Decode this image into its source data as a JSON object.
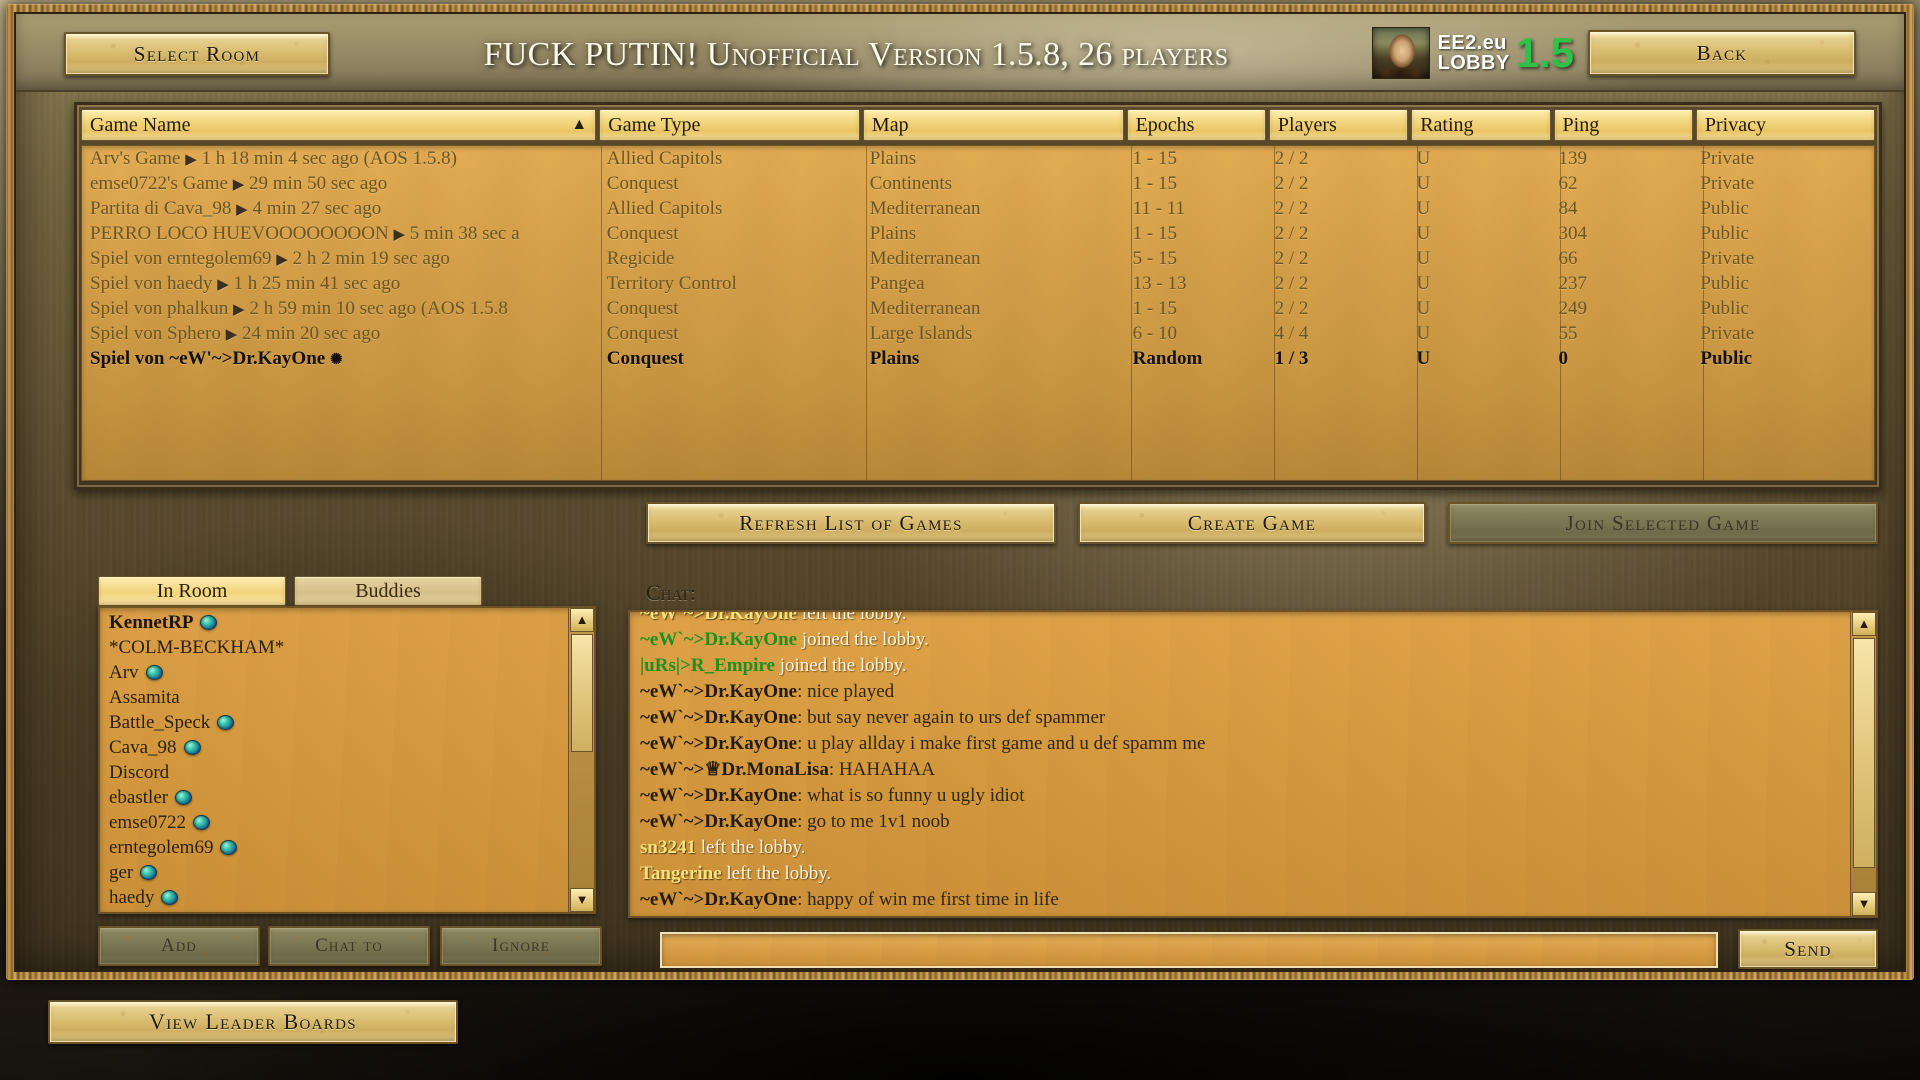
{
  "header": {
    "select_room_label": "Select Room",
    "title": "FUCK PUTIN! Unofficial Version 1.5.8, 26 players",
    "back_label": "Back",
    "logo": {
      "line1": "EE2.eu",
      "line2": "LOBBY",
      "version": "1.5",
      "version_color": "#2fc14a",
      "portrait_icon": "mona-lisa-icon"
    }
  },
  "games_table": {
    "columns": [
      "Game Name",
      "Game Type",
      "Map",
      "Epochs",
      "Players",
      "Rating",
      "Ping",
      "Privacy"
    ],
    "sort_column": "Game Name",
    "sort_indicator": "▲",
    "rows": [
      {
        "name": "Arv's Game",
        "play_icon": "▶",
        "time": "1 h 18 min 4 sec ago (AOS 1.5.8)",
        "type": "Allied Capitols",
        "map": "Plains",
        "epochs": "1 - 15",
        "players": "2 / 2",
        "rating": "U",
        "ping": "139",
        "privacy": "Private",
        "own": false
      },
      {
        "name": "emse0722's Game",
        "play_icon": "▶",
        "time": "29 min 50 sec ago",
        "type": "Conquest",
        "map": "Continents",
        "epochs": "1 - 15",
        "players": "2 / 2",
        "rating": "U",
        "ping": "62",
        "privacy": "Private",
        "own": false
      },
      {
        "name": "Partita di Cava_98",
        "play_icon": "▶",
        "time": "4 min 27 sec ago",
        "type": "Allied Capitols",
        "map": "Mediterranean",
        "epochs": "11 - 11",
        "players": "2 / 2",
        "rating": "U",
        "ping": "84",
        "privacy": "Public",
        "own": false
      },
      {
        "name": "PERRO LOCO HUEVOOOOOOOON",
        "play_icon": "▶",
        "time": "5 min 38 sec a",
        "type": "Conquest",
        "map": "Plains",
        "epochs": "1 - 15",
        "players": "2 / 2",
        "rating": "U",
        "ping": "304",
        "privacy": "Public",
        "own": false
      },
      {
        "name": "Spiel von erntegolem69",
        "play_icon": "▶",
        "time": "2 h 2 min 19 sec ago",
        "type": "Regicide",
        "map": "Mediterranean",
        "epochs": "5 - 15",
        "players": "2 / 2",
        "rating": "U",
        "ping": "66",
        "privacy": "Private",
        "own": false
      },
      {
        "name": "Spiel von haedy",
        "play_icon": "▶",
        "time": "1 h 25 min 41 sec ago",
        "type": "Territory Control",
        "map": "Pangea",
        "epochs": "13 - 13",
        "players": "2 / 2",
        "rating": "U",
        "ping": "237",
        "privacy": "Public",
        "own": false
      },
      {
        "name": "Spiel von phalkun",
        "play_icon": "▶",
        "time": "2 h 59 min 10 sec ago (AOS 1.5.8",
        "type": "Conquest",
        "map": "Mediterranean",
        "epochs": "1 - 15",
        "players": "2 / 2",
        "rating": "U",
        "ping": "249",
        "privacy": "Public",
        "own": false
      },
      {
        "name": "Spiel von Sphero",
        "play_icon": "▶",
        "time": "24 min 20 sec ago",
        "type": "Conquest",
        "map": "Large Islands",
        "epochs": "6 - 10",
        "players": "4 / 4",
        "rating": "U",
        "ping": "55",
        "privacy": "Private",
        "own": false
      },
      {
        "name": "Spiel von ~eW'~>Dr.KayOne",
        "play_icon": "✺",
        "time": "",
        "type": "Conquest",
        "map": "Plains",
        "epochs": "Random",
        "players": "1 / 3",
        "rating": "U",
        "ping": "0",
        "privacy": "Public",
        "own": true
      }
    ]
  },
  "actions": {
    "refresh_label": "Refresh List of Games",
    "create_label": "Create Game",
    "join_label": "Join Selected Game",
    "join_disabled": true
  },
  "tabs": [
    {
      "label": "In Room",
      "active": true
    },
    {
      "label": "Buddies",
      "active": false
    }
  ],
  "player_list": [
    {
      "name": "KennetRP",
      "globe": true,
      "me": true
    },
    {
      "name": "*COLM-BECKHAM*",
      "globe": false,
      "me": false
    },
    {
      "name": "Arv",
      "globe": true,
      "me": false
    },
    {
      "name": "Assamita",
      "globe": false,
      "me": false
    },
    {
      "name": "Battle_Speck",
      "globe": true,
      "me": false
    },
    {
      "name": "Cava_98",
      "globe": true,
      "me": false
    },
    {
      "name": "Discord",
      "globe": false,
      "me": false
    },
    {
      "name": "ebastler",
      "globe": true,
      "me": false
    },
    {
      "name": "emse0722",
      "globe": true,
      "me": false
    },
    {
      "name": "erntegolem69",
      "globe": true,
      "me": false
    },
    {
      "name": "ger",
      "globe": true,
      "me": false
    },
    {
      "name": "haedy",
      "globe": true,
      "me": false
    }
  ],
  "chat": {
    "label": "Chat:",
    "input_value": "",
    "send_label": "Send",
    "lines": [
      {
        "name": "~eW`~>Dr.KayOne",
        "name_style": "gold",
        "msg": " left the lobby.",
        "msg_style": "sys",
        "clipped": true
      },
      {
        "name": "~eW`~>Dr.KayOne",
        "name_style": "green",
        "msg": " joined the lobby.",
        "msg_style": "sys"
      },
      {
        "name": "|uRs|>R_Empire",
        "name_style": "green",
        "msg": " joined the lobby.",
        "msg_style": "sys"
      },
      {
        "name": "~eW`~>Dr.KayOne",
        "name_style": "dark",
        "msg": ": nice played",
        "msg_style": "normal"
      },
      {
        "name": "~eW`~>Dr.KayOne",
        "name_style": "dark",
        "msg": ": but say never again to urs def spammer",
        "msg_style": "normal"
      },
      {
        "name": "~eW`~>Dr.KayOne",
        "name_style": "dark",
        "msg": ": u play allday i make first game and u def spamm me",
        "msg_style": "normal"
      },
      {
        "name": "~eW`~>♕Dr.MonaLisa",
        "name_style": "dark",
        "msg": ": HAHAHAA",
        "msg_style": "normal"
      },
      {
        "name": "~eW`~>Dr.KayOne",
        "name_style": "dark",
        "msg": ": what is so funny u ugly idiot",
        "msg_style": "normal"
      },
      {
        "name": "~eW`~>Dr.KayOne",
        "name_style": "dark",
        "msg": ": go to me 1v1 noob",
        "msg_style": "normal"
      },
      {
        "name": "sn3241",
        "name_style": "gold",
        "msg": " left the lobby.",
        "msg_style": "sys"
      },
      {
        "name": "Tangerine",
        "name_style": "gold",
        "msg": " left the lobby.",
        "msg_style": "sys"
      },
      {
        "name": "~eW`~>Dr.KayOne",
        "name_style": "dark",
        "msg": ": happy of win me first time in life",
        "msg_style": "normal"
      }
    ]
  },
  "buddy_actions": [
    {
      "label": "Add",
      "disabled": true
    },
    {
      "label": "Chat to",
      "disabled": true
    },
    {
      "label": "Ignore",
      "disabled": true
    }
  ],
  "footer": {
    "leader_boards_label": "View Leader Boards"
  },
  "scroll": {
    "up_arrow": "▲",
    "down_arrow": "▼"
  }
}
